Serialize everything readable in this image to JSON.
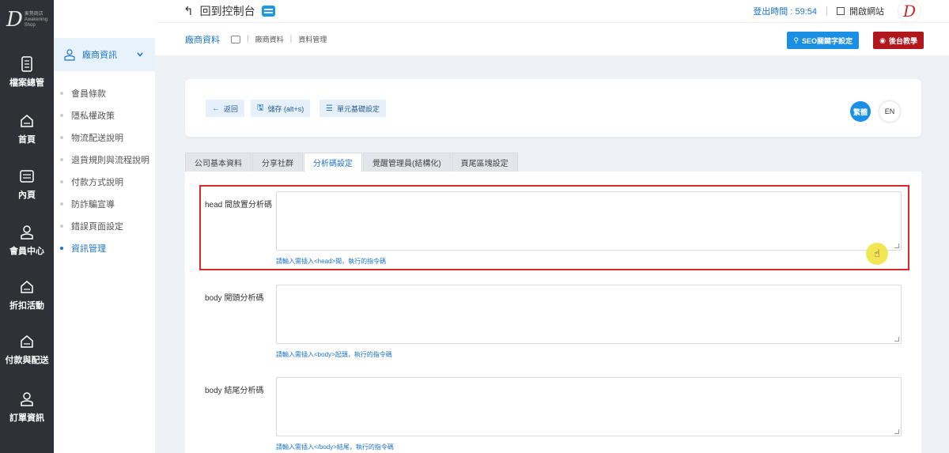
{
  "rail": {
    "logo_mark": "D",
    "logo_sub1": "東勢商店",
    "logo_sub2": "Awakening",
    "logo_sub3": "Shop",
    "items": [
      {
        "label": "檔案總管",
        "icon": "file-icon"
      },
      {
        "label": "首頁",
        "icon": "home-icon"
      },
      {
        "label": "內頁",
        "icon": "page-icon"
      },
      {
        "label": "會員中心",
        "icon": "member-icon"
      },
      {
        "label": "折扣活動",
        "icon": "home-icon"
      },
      {
        "label": "付款與配送",
        "icon": "home-icon"
      },
      {
        "label": "訂單資訊",
        "icon": "member-icon"
      }
    ]
  },
  "sidebar": {
    "group_label": "廠商資訊",
    "items": [
      {
        "label": "會員條款",
        "active": false
      },
      {
        "label": "隱私權政策",
        "active": false
      },
      {
        "label": "物流配送說明",
        "active": false
      },
      {
        "label": "退貨規則與流程說明",
        "active": false
      },
      {
        "label": "付款方式說明",
        "active": false
      },
      {
        "label": "防詐騙宣導",
        "active": false
      },
      {
        "label": "錯誤頁面設定",
        "active": false
      },
      {
        "label": "資訊管理",
        "active": true
      }
    ]
  },
  "header": {
    "back_label": "回到控制台",
    "logout_time": "登出時間 : 59:54",
    "open_site": "開啟網站",
    "avatar": "D"
  },
  "breadcrumb": {
    "title": "廠商資料",
    "items": [
      "廠商資料",
      "資料管理"
    ],
    "seo_button": "SEO關鍵字設定",
    "help_button": "後台教學"
  },
  "actions": {
    "back": "返回",
    "save": "儲存 (alt+s)",
    "unit_settings": "單元基礎設定",
    "lang_active": "繁體",
    "lang_other": "EN"
  },
  "tabs": [
    {
      "label": "公司基本資料",
      "active": false
    },
    {
      "label": "分享社群",
      "active": false
    },
    {
      "label": "分析碼設定",
      "active": true
    },
    {
      "label": "覺醒管理員(結構化)",
      "active": false
    },
    {
      "label": "頁尾區塊設定",
      "active": false
    }
  ],
  "form": {
    "head_label": "head 間放置分析碼",
    "head_hint": "請輸入需插入<head>間，執行的指令碼",
    "body_start_label": "body 開頭分析碼",
    "body_start_hint": "請輸入需插入<body>起頭，執行的指令碼",
    "body_end_label": "body 結尾分析碼",
    "body_end_hint": "請輸入需插入</body>結尾，執行的指令碼"
  },
  "colors": {
    "accent": "#1a73c8",
    "rail_bg": "#2e3237",
    "help_red": "#b0161c",
    "highlight_red": "#d62a2a"
  }
}
